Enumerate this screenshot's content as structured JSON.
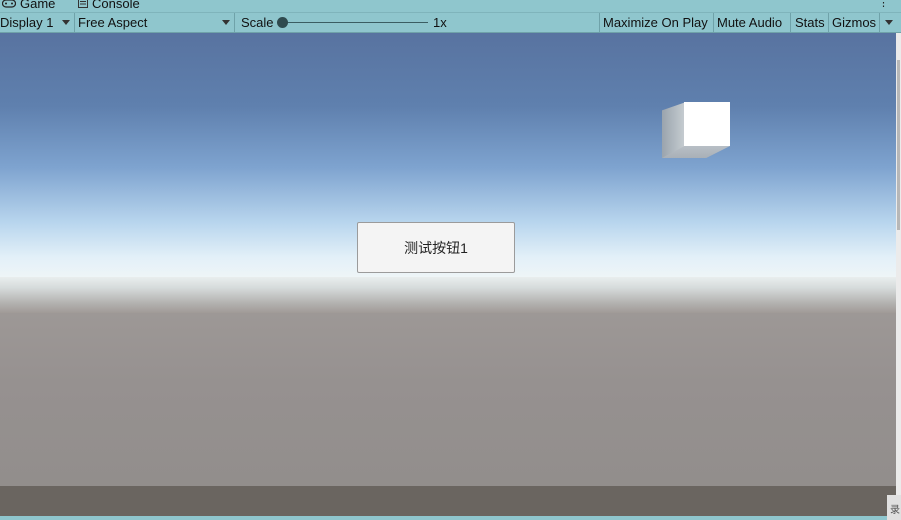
{
  "tabs": {
    "game": {
      "label": "Game",
      "icon": "gamepad-icon"
    },
    "console": {
      "label": "Console",
      "icon": "console-icon"
    }
  },
  "toolbar": {
    "display": "Display 1",
    "aspect": "Free Aspect",
    "scale_label": "Scale",
    "scale_value": "1x",
    "scale_level": 0,
    "maximize_on_play": "Maximize On Play",
    "mute_audio": "Mute Audio",
    "stats": "Stats",
    "gizmos": "Gizmos"
  },
  "game_view": {
    "button_label": "测试按钮1"
  },
  "corner_glyph": "录",
  "colors": {
    "toolbar_bg": "#8fc6cd",
    "sky_top": "#5873a0",
    "sky_horizon": "#eef5f7",
    "ground": "#969190",
    "button_bg": "#f4f4f4"
  }
}
